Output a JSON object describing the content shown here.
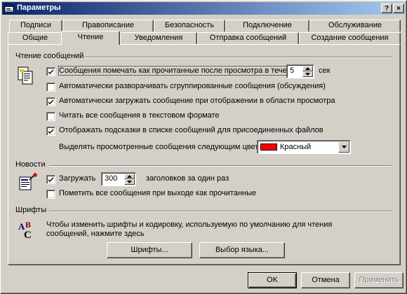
{
  "window": {
    "title": "Параметры",
    "help_label": "?",
    "close_label": "×"
  },
  "tabs": {
    "back_row": [
      "Подписи",
      "Правописание",
      "Безопасность",
      "Подключение",
      "Обслуживание"
    ],
    "front_row": [
      "Общие",
      "Чтение",
      "Уведомления",
      "Отправка сообщений",
      "Создание сообщения"
    ],
    "active": "Чтение"
  },
  "reading": {
    "title": "Чтение сообщений",
    "mark_read": {
      "label": "Сообщения помечать как прочитанные после просмотра в течение",
      "checked": true
    },
    "mark_read_seconds": "5",
    "seconds_unit": "сек",
    "expand_groups": {
      "label": "Автоматически разворачивать сгруппированные сообщения (обсуждения)",
      "checked": false
    },
    "auto_download": {
      "label": "Автоматически загружать сообщение при отображении в области просмотра",
      "checked": true
    },
    "plain_text": {
      "label": "Читать все сообщения в текстовом формате",
      "checked": false
    },
    "tooltips": {
      "label": "Отображать подсказки в списке сообщений для присоединенных файлов",
      "checked": true
    },
    "highlight_label": "Выделять просмотренные сообщения следующим цветом:",
    "highlight_color": "Красный",
    "highlight_color_hex": "#ff0000"
  },
  "news": {
    "title": "Новости",
    "download": {
      "label": "Загружать",
      "checked": true
    },
    "headers_count": "300",
    "headers_suffix": "заголовков за один раз",
    "mark_on_exit": {
      "label": "Пометить все сообщения при выходе как прочитанные",
      "checked": false
    }
  },
  "fonts": {
    "title": "Шрифты",
    "description_line1": "Чтобы изменить шрифты и кодировку, используемую по умолчанию для чтения",
    "description_line2": "сообщений, нажмите здесь",
    "fonts_button": "Шрифты...",
    "language_button": "Выбор языка..."
  },
  "footer": {
    "ok": "OK",
    "cancel": "Отмена",
    "apply": "Применить"
  },
  "icons": {
    "reading": "document-read-icon",
    "news": "newspaper-pin-icon",
    "fonts": "font-abc-icon"
  },
  "colors": {
    "title_start": "#0a246a",
    "title_end": "#a6caf0",
    "face": "#d4d0c8"
  }
}
